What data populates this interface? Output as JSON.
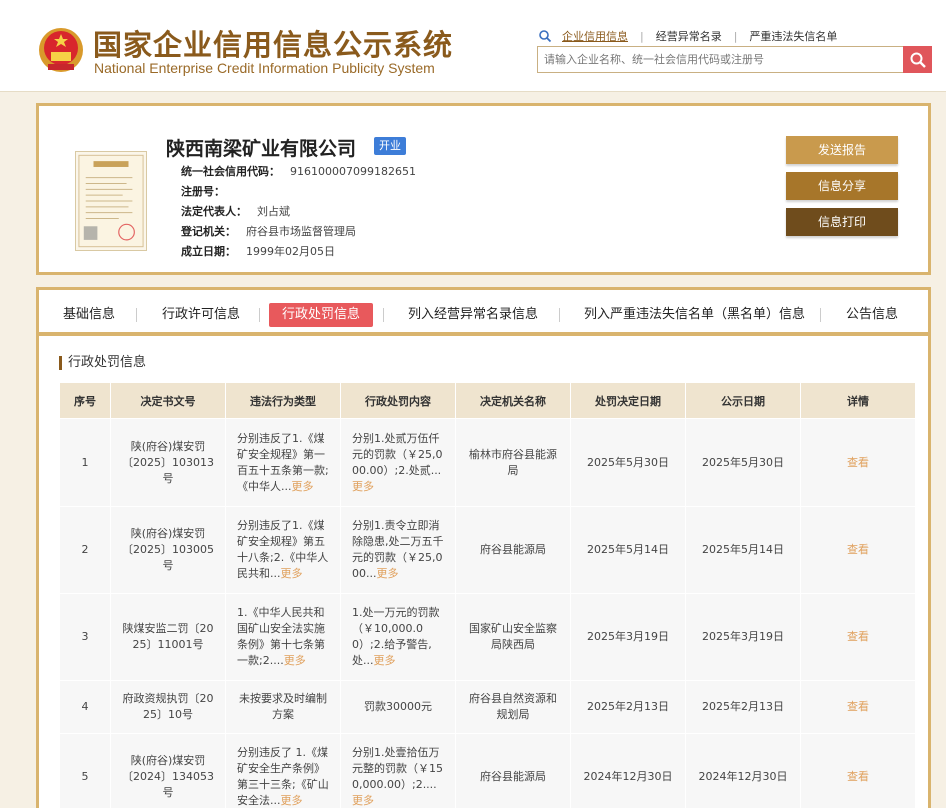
{
  "header": {
    "logo_cn": "国家企业信用信息公示系统",
    "logo_en": "National Enterprise Credit Information Publicity System",
    "search_tabs": [
      "企业信用信息",
      "经营异常名录",
      "严重违法失信名单"
    ],
    "search_placeholder": "请输入企业名称、统一社会信用代码或注册号"
  },
  "company": {
    "name": "陕西南梁矿业有限公司",
    "status": "开业",
    "fields": [
      {
        "label": "统一社会信用代码：",
        "value": "916100007099182651"
      },
      {
        "label": "注册号：",
        "value": ""
      },
      {
        "label": "法定代表人：",
        "value": "刘占斌"
      },
      {
        "label": "登记机关：",
        "value": "府谷县市场监督管理局"
      },
      {
        "label": "成立日期：",
        "value": "1999年02月05日"
      }
    ],
    "actions": [
      "发送报告",
      "信息分享",
      "信息打印"
    ]
  },
  "tabs": [
    "基础信息",
    "行政许可信息",
    "行政处罚信息",
    "列入经营异常名录信息",
    "列入严重违法失信名单（黑名单）信息",
    "公告信息"
  ],
  "section_title": "行政处罚信息",
  "table": {
    "headers": [
      "序号",
      "决定书文号",
      "违法行为类型",
      "行政处罚内容",
      "决定机关名称",
      "处罚决定日期",
      "公示日期",
      "详情"
    ],
    "more_label": "更多",
    "view_label": "查看",
    "rows": [
      {
        "no": "1",
        "doc": "陕(府谷)煤安罚〔2025〕103013号",
        "type": "分别违反了1.《煤矿安全规程》第一百五十五条第一款;《中华人...",
        "content": "分别1.处贰万伍仟元的罚款（￥25,000.00）;2.处贰...",
        "authority": "榆林市府谷县能源局",
        "decision_date": "2025年5月30日",
        "publish_date": "2025年5月30日"
      },
      {
        "no": "2",
        "doc": "陕(府谷)煤安罚〔2025〕103005号",
        "type": "分别违反了1.《煤矿安全规程》第五十八条;2.《中华人民共和...",
        "content": "分别1.责令立即消除隐患,处二万五千元的罚款（￥25,000...",
        "authority": "府谷县能源局",
        "decision_date": "2025年5月14日",
        "publish_date": "2025年5月14日"
      },
      {
        "no": "3",
        "doc": "陕煤安监二罚〔2025〕11001号",
        "type": "1.《中华人民共和国矿山安全法实施条例》第十七条第一款;2....",
        "content": "1.处一万元的罚款（￥10,000.00）;2.给予警告,处...",
        "authority": "国家矿山安全监察局陕西局",
        "decision_date": "2025年3月19日",
        "publish_date": "2025年3月19日"
      },
      {
        "no": "4",
        "doc": "府政资规执罚〔2025〕10号",
        "type": "未按要求及时编制方案",
        "content": "罚款30000元",
        "authority": "府谷县自然资源和规划局",
        "decision_date": "2025年2月13日",
        "publish_date": "2025年2月13日"
      },
      {
        "no": "5",
        "doc": "陕(府谷)煤安罚〔2024〕134053号",
        "type": "分别违反了 1.《煤矿安全生产条例》第三十三条;《矿山安全法...",
        "content": "分别1.处壹拾伍万元整的罚款（￥150,000.00）;2....",
        "authority": "府谷县能源局",
        "decision_date": "2024年12月30日",
        "publish_date": "2024年12月30日"
      }
    ]
  }
}
